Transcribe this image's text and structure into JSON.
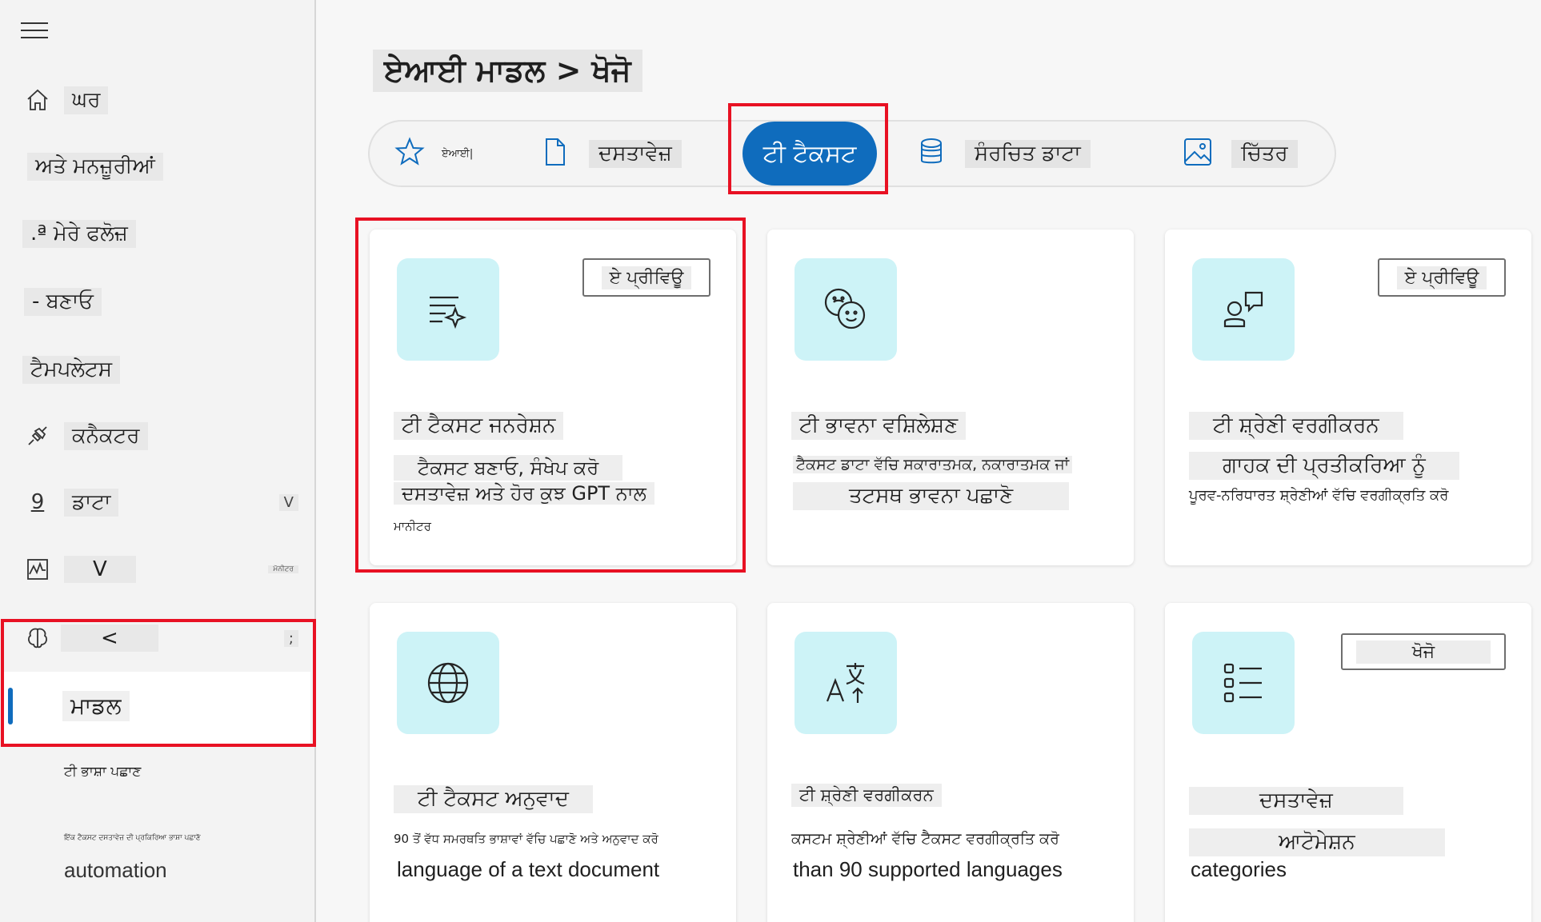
{
  "sidebar": {
    "items": [
      {
        "label": "ਘਰ"
      },
      {
        "label": "ਅਤੇ ਮਨਜ਼ੂਰੀਆਂ"
      },
      {
        "label": ".ª ਮੇਰੇ ਫਲੋਜ਼"
      },
      {
        "label": "- ਬਣਾਓ"
      },
      {
        "label": "ਟੈਮਪਲੇਟਸ"
      },
      {
        "label": "ਕਨੈਕਟਰ"
      },
      {
        "label": "ਡਾਟਾ",
        "icon_text": "9",
        "right": "V"
      },
      {
        "label": "V",
        "right": "ਮੋਨੀਟਰ"
      },
      {
        "label": "<",
        "right": ";"
      }
    ],
    "selected_label": "ਮਾਡਲ",
    "sub1": "ਟੀ ਭਾਸ਼ਾ ਪਛਾਣ",
    "sub2": "ਇੱਕ ਟੈਕਸਟ ਦਸਤਾਵੇਜ਼ ਦੀ ਪ੍ਰਕਿਰਿਆ ਭਾਸ਼ਾ ਪਛਾਣੋ",
    "sub3": "automation"
  },
  "breadcrumb": "ਏਆਈ ਮਾਡਲ > ਖੋਜੋ",
  "tabs": [
    {
      "label": "ਏਆਈ|",
      "icon": "star-icon"
    },
    {
      "label": "ਦਸਤਾਵੇਜ਼",
      "icon": "document-icon"
    },
    {
      "label": "ਟੀ ਟੈਕਸਟ"
    },
    {
      "label": "ਸੰਰਚਿਤ ਡਾਟਾ",
      "icon": "database-icon"
    },
    {
      "label": "ਚਿੱਤਰ",
      "icon": "image-icon"
    }
  ],
  "cards": [
    {
      "badge": "ਏ ਪ੍ਰੀਵਿਊ",
      "title": "ਟੀ ਟੈਕਸਟ ਜਨਰੇਸ਼ਨ",
      "line1": "ਟੈਕਸਟ ਬਣਾਓ, ਸੰਖੇਪ ਕਰੋ",
      "line2": "ਦਸਤਾਵੇਜ਼ ਅਤੇ ਹੋਰ ਕੁਝ GPT ਨਾਲ",
      "line3": "ਮਾਨੀਟਰ",
      "icon": "text-sparkle-icon"
    },
    {
      "title": "ਟੀ ਭਾਵਨਾ ਵਸ਼ਿਲੇਸ਼ਣ",
      "line1": "ਟੈਕਸਟ ਡਾਟਾ ਵੱਚਿ ਸਕਾਰਾਤਮਕ, ਨਕਾਰਾਤਮਕ ਜਾਂ",
      "line2": "ਤਟਸਥ ਭਾਵਨਾ ਪਛਾਣੋ",
      "icon": "emoji-faces-icon"
    },
    {
      "badge": "ਏ ਪ੍ਰੀਵਿਊ",
      "title": "ਟੀ ਸ਼੍ਰੇਣੀ ਵਰਗੀਕਰਨ",
      "line1": "ਗਾਹਕ ਦੀ ਪ੍ਰਤੀਕਰਿਆ ਨੂੰ",
      "line2": "ਪੂਰਵ-ਨਰਿਧਾਰਤ ਸ਼੍ਰੇਣੀਆਂ ਵੱਚਿ ਵਰਗੀਕ੍ਰਤਿ ਕਰੋ",
      "icon": "person-chat-icon"
    },
    {
      "title": "ਟੀ ਟੈਕਸਟ ਅਨੁਵਾਦ",
      "line1": "90 ਤੋਂ ਵੱਧ ਸਮਰਥਤਿ ਭਾਸ਼ਾਵਾਂ ਵੱਚਿ ਪਛਾਣੋ ਅਤੇ ਅਨੁਵਾਦ ਕਰੋ",
      "line2": "language of a text document",
      "icon": "globe-icon"
    },
    {
      "title": "ਟੀ ਸ਼੍ਰੇਣੀ ਵਰਗੀਕਰਨ",
      "line1": "ਕਸਟਮ ਸ਼੍ਰੇਣੀਆਂ ਵੱਚਿ ਟੈਕਸਟ ਵਰਗੀਕ੍ਰਤਿ ਕਰੋ",
      "line2": "than 90 supported languages",
      "icon": "translate-icon"
    },
    {
      "badge": "ਖੋਜੋ",
      "title": "ਦਸਤਾਵੇਜ਼",
      "line1": "ਆਟੋਮੇਸ਼ਨ",
      "line2": "categories",
      "icon": "list-icon"
    }
  ],
  "colors": {
    "accent": "#0f6cbd",
    "highlight": "#e81123",
    "icon_tile": "#cdf3f7"
  }
}
